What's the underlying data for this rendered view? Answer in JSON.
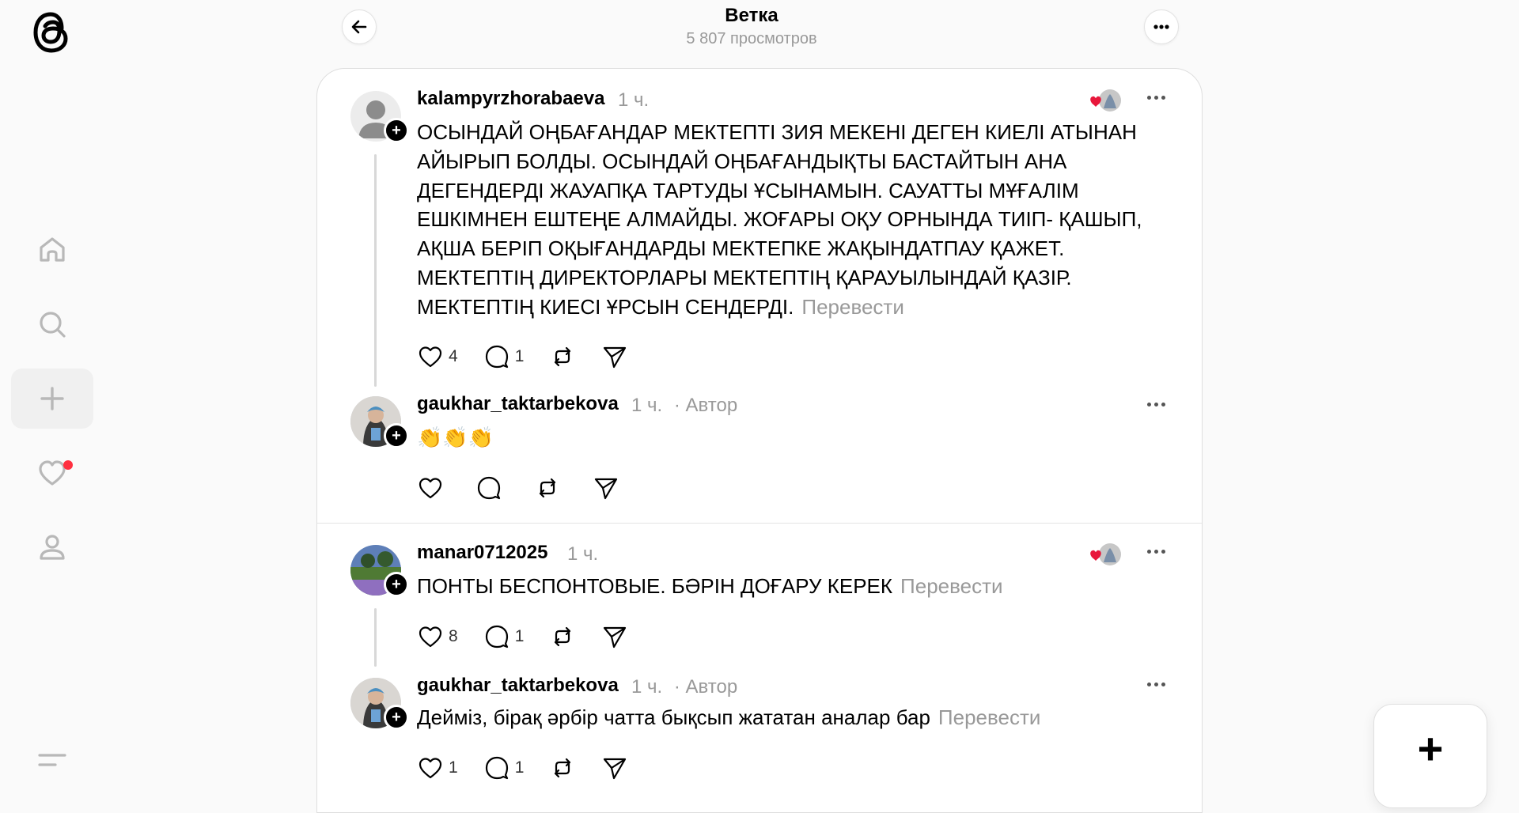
{
  "header": {
    "title": "Ветка",
    "views": "5 807 просмотров"
  },
  "posts": [
    {
      "username": "kalampyrzhorabaeva",
      "time": "1 ч.",
      "text": "ОСЫНДАЙ ОҢБАҒАНДАР МЕКТЕПТІ ЗИЯ МЕКЕНІ ДЕГЕН КИЕЛІ АТЫНАН АЙЫРЫП БОЛДЫ. ОСЫНДАЙ ОҢБАҒАНДЫҚТЫ БАСТАЙТЫН АНА ДЕГЕНДЕРДІ ЖАУАПҚА ТАРТУДЫ ҰСЫНАМЫН. САУАТТЫ МҰҒАЛІМ ЕШКІМНЕН ЕШТЕҢЕ АЛМАЙДЫ. ЖОҒАРЫ ОҚУ ОРНЫНДА ТИІП- ҚАШЫП, АҚША БЕРІП ОҚЫҒАНДАРДЫ МЕКТЕПКЕ ЖАҚЫНДАТПАУ ҚАЖЕТ. МЕКТЕПТІҢ ДИРЕКТОРЛАРЫ МЕКТЕПТІҢ ҚАРАУЫЛЫНДАЙ ҚАЗІР. МЕКТЕПТІҢ КИЕСІ ҰРСЫН СЕНДЕРДІ.",
      "translate": "Перевести",
      "likes": "4",
      "replies": "1"
    },
    {
      "username": "gaukhar_taktarbekova",
      "time": "1 ч.",
      "author_badge": "· Автор",
      "text": "👏👏👏"
    },
    {
      "username": "manar0712025",
      "time": "1 ч.",
      "text": "ПОНТЫ БЕСПОНТОВЫЕ. БӘРІН ДОҒАРУ КЕРЕК",
      "translate": "Перевести",
      "likes": "8",
      "replies": "1"
    },
    {
      "username": "gaukhar_taktarbekova",
      "time": "1 ч.",
      "author_badge": "· Автор",
      "text": "Деймiз, бiрақ әрбiр чатта бықсып жататан аналар бар",
      "translate": "Перевести",
      "likes": "1",
      "replies": "1"
    }
  ],
  "fab_label": "+"
}
